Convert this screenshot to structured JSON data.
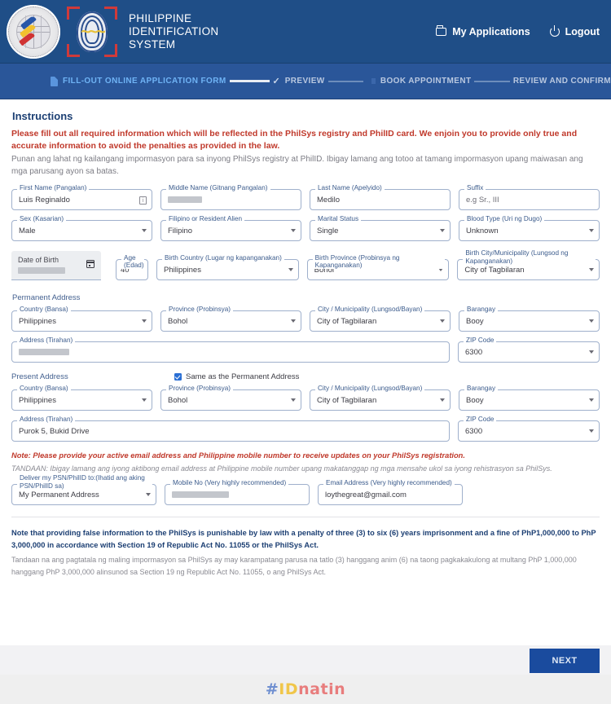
{
  "header": {
    "brand_line1": "PHILIPPINE",
    "brand_line2": "IDENTIFICATION",
    "brand_line3": "SYSTEM",
    "my_applications": "My Applications",
    "logout": "Logout",
    "bg_color": "#1f4e87"
  },
  "stepper": {
    "steps": [
      {
        "label": "FILL-OUT ONLINE APPLICATION FORM",
        "state": "active"
      },
      {
        "label": "PREVIEW",
        "state": "pending"
      },
      {
        "label": "BOOK APPOINTMENT",
        "state": "pending"
      },
      {
        "label": "REVIEW AND CONFIRM",
        "state": "pending"
      }
    ],
    "active_color": "#6fb3f5"
  },
  "instructions": {
    "title": "Instructions",
    "english": "Please fill out all required information which will be reflected in the PhilSys registry and PhilID card. We enjoin you to provide only true and accurate information to avoid the penalties as provided in the law.",
    "filipino": "Punan ang lahat ng kailangang impormasyon para sa inyong PhilSys registry at PhilID. Ibigay lamang ang totoo at tamang impormasyon upang maiwasan ang mga parusang ayon sa batas."
  },
  "form": {
    "first_name": {
      "label": "First Name (Pangalan)",
      "value": "Luis Reginaldo"
    },
    "middle_name": {
      "label": "Middle Name (Gitnang Pangalan)",
      "value": "",
      "redacted": true
    },
    "last_name": {
      "label": "Last Name (Apelyido)",
      "value": "Medilo"
    },
    "suffix": {
      "label": "Suffix",
      "value": "",
      "placeholder": "e.g Sr., III"
    },
    "sex": {
      "label": "Sex (Kasarian)",
      "value": "Male"
    },
    "citizenship": {
      "label": "Filipino or Resident Alien",
      "value": "Filipino"
    },
    "marital_status": {
      "label": "Marital Status",
      "value": "Single"
    },
    "blood_type": {
      "label": "Blood Type (Uri ng Dugo)",
      "value": "Unknown"
    },
    "date_of_birth": {
      "label": "Date of Birth",
      "value": "",
      "redacted": true
    },
    "age": {
      "label": "Age (Edad)",
      "value": "40"
    },
    "birth_country": {
      "label": "Birth Country (Lugar ng kapanganakan)",
      "value": "Philippines"
    },
    "birth_province": {
      "label": "Birth Province (Probinsya ng Kapanganakan)",
      "value": "Bohol"
    },
    "birth_city": {
      "label": "Birth City/Municipality (Lungsod ng Kapanganakan)",
      "value": "City of Tagbilaran"
    },
    "permanent_address_title": "Permanent Address",
    "perm_country": {
      "label": "Country (Bansa)",
      "value": "Philippines"
    },
    "perm_province": {
      "label": "Province (Probinsya)",
      "value": "Bohol"
    },
    "perm_city": {
      "label": "City / Municipality (Lungsod/Bayan)",
      "value": "City of Tagbilaran"
    },
    "perm_barangay": {
      "label": "Barangay",
      "value": "Booy"
    },
    "perm_address": {
      "label": "Address (Tirahan)",
      "value": "",
      "redacted": true
    },
    "perm_zip": {
      "label": "ZIP Code",
      "value": "6300"
    },
    "present_address_title": "Present Address",
    "same_as_permanent": {
      "label": "Same as the Permanent Address",
      "checked": true
    },
    "pres_country": {
      "label": "Country (Bansa)",
      "value": "Philippines"
    },
    "pres_province": {
      "label": "Province (Probinsya)",
      "value": "Bohol"
    },
    "pres_city": {
      "label": "City / Municipality (Lungsod/Bayan)",
      "value": "City of Tagbilaran"
    },
    "pres_barangay": {
      "label": "Barangay",
      "value": "Booy"
    },
    "pres_address": {
      "label": "Address (Tirahan)",
      "value": "Purok 5, Bukid Drive"
    },
    "pres_zip": {
      "label": "ZIP Code",
      "value": "6300"
    },
    "note_red": "Note: Please provide your active email address and Philippine mobile number to receive updates on your PhilSys registration.",
    "note_gray": "TANDAAN: Ibigay lamang ang iyong aktibong email address at Philippine mobile number upang makatanggap ng mga mensahe ukol sa iyong rehistrasyon sa PhilSys.",
    "delivery": {
      "label": "Deliver my PSN/PhilID to:(Ihatid ang aking PSN/PhilID sa)",
      "value": "My Permanent Address"
    },
    "mobile": {
      "label": "Mobile No (Very highly recommended)",
      "value": "",
      "redacted": true
    },
    "email": {
      "label": "Email Address (Very highly recommended)",
      "value": "loythegreat@gmail.com"
    }
  },
  "legal": {
    "english": "Note that providing false information to the PhilSys is punishable by law with a penalty of three (3) to six (6) years imprisonment and a fine of PhP1,000,000 to PhP 3,000,000 in accordance with Section 19 of Republic Act No. 11055 or the PhilSys Act.",
    "filipino": "Tandaan na ang pagtatala ng maling impormasyon sa PhilSys ay may karampatang parusa na tatlo (3) hanggang anim (6) na taong pagkakakulong at multang PhP 1,000,000 hanggang PhP 3,000,000 alinsunod sa Section 19 ng Republic Act No. 11055, o ang PhilSys Act."
  },
  "footer": {
    "next_label": "NEXT",
    "next_color": "#1a4b9e",
    "watermark_hash": "#",
    "watermark_id": "ID",
    "watermark_natin": "natin"
  }
}
